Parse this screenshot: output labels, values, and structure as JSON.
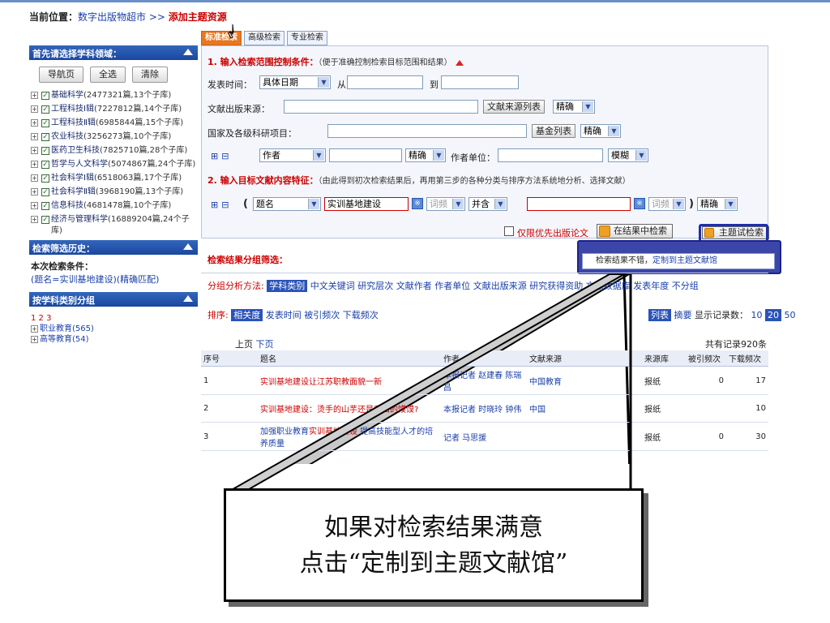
{
  "breadcrumb": {
    "label": "当前位置：",
    "site": "数字出版物超市",
    "sep": " >> ",
    "current": "添加主题资源"
  },
  "tabs": [
    {
      "label": "标准检索"
    },
    {
      "label": "高级检索"
    },
    {
      "label": "专业检索"
    }
  ],
  "left": {
    "subject_header": "首先请选择学科领域：",
    "buttons": [
      "导航页",
      "全选",
      "清除"
    ],
    "tree": [
      {
        "label": "基础科学",
        "sub": "(2477321篇,13个子库)"
      },
      {
        "label": "工程科技Ⅰ辑",
        "sub": "(7227812篇,14个子库)"
      },
      {
        "label": "工程科技Ⅱ辑",
        "sub": "(6985844篇,15个子库)"
      },
      {
        "label": "农业科技",
        "sub": "(3256273篇,10个子库)"
      },
      {
        "label": "医药卫生科技",
        "sub": "(7825710篇,28个子库)"
      },
      {
        "label": "哲学与人文科学",
        "sub": "(5074867篇,24个子库)"
      },
      {
        "label": "社会科学Ⅰ辑",
        "sub": "(6518063篇,17个子库)"
      },
      {
        "label": "社会科学Ⅱ辑",
        "sub": "(3968190篇,13个子库)"
      },
      {
        "label": "信息科技",
        "sub": "(4681478篇,10个子库)"
      },
      {
        "label": "经济与管理科学",
        "sub": "(16889204篇,24个子库)"
      }
    ],
    "history_header": "检索筛选历史：",
    "condition_label": "本次检索条件：",
    "condition_value": "(题名=实训基地建设)(精确匹配)",
    "group_header": "按学科类别分组",
    "group_pages": "1 2 3",
    "groups": [
      "职业教育(565)",
      "高等教育(54)"
    ]
  },
  "form": {
    "step1": "1. 输入检索范围控制条件：",
    "step1_note": "（便于准确控制检索目标范围和结果）",
    "pubtime_label": "发表时间：",
    "pubtime_select": "具体日期",
    "from_label": "从",
    "to_label": "到",
    "source_label": "文献出版来源：",
    "source_list_btn": "文献来源列表",
    "exact": "精确",
    "fund_label": "国家及各级科研项目：",
    "fund_list_btn": "基金列表",
    "author_select": "作者",
    "unit_label": "作者单位：",
    "fuzzy": "模糊",
    "step2": "2. 输入目标文献内容特征：",
    "step2_note": "（由此得到初次检索结果后，再用第三步的各种分类与排序方法系统地分析、选择文献）",
    "title_select": "题名",
    "title_value": "实训基地建设",
    "freq_select": "词频",
    "contains_select": "并含",
    "first_pub_label": "仅限优先出版论文",
    "search_in_results": "在结果中检索",
    "theme_search": "主题试检索"
  },
  "popup": {
    "text_prefix": "检索结果不错，",
    "text_link": "定制到主题文献馆"
  },
  "results": {
    "group_title": "检索结果分组筛选：",
    "methods_label": "分组分析方法:",
    "method_active": "学科类别",
    "methods": [
      "中文关键词",
      "研究层次",
      "文献作者",
      "作者单位",
      "文献出版来源",
      "研究获得资助",
      "文献数据库",
      "发表年度",
      "不分组"
    ],
    "sort_label": "排序:",
    "sort_active": "相关度",
    "sorts": [
      "发表时间",
      "被引频次",
      "下载频次"
    ],
    "list_label": "列表",
    "abstract_label": "摘要",
    "count_label": "显示记录数：",
    "counts": [
      "10",
      "20",
      "50"
    ],
    "prev": "上页",
    "next": "下页",
    "total": "共有记录920条",
    "columns": [
      "序号",
      "题名",
      "作者",
      "文献来源",
      "来源库",
      "被引频次",
      "下载频次"
    ],
    "rows": [
      {
        "no": "1",
        "title_hl": "实训基地建设",
        "title_rest": "让江苏职教面貌一新",
        "author": "本报记者 赵建春 陈瑞昌",
        "source": "中国教育",
        "db": "报纸",
        "cited": "0",
        "dl": "17"
      },
      {
        "no": "2",
        "title_hl": "实训基地建设",
        "title_rest": "：烫手的山芋还是香口的馍馍?",
        "author": "本报记者 时晓玲 钟伟",
        "source": "中国",
        "db": "报纸",
        "cited": "",
        "dl": "10"
      },
      {
        "no": "3",
        "title_pre": "加强职业教育",
        "title_hl": "实训基地建设",
        "title_rest": " 提高技能型人才的培养质量",
        "author": "记者 马思援",
        "source": "",
        "db": "报纸",
        "cited": "0",
        "dl": "30"
      }
    ]
  },
  "callout": {
    "line1": "如果对检索结果满意",
    "line2": "点击“定制到主题文献馆”"
  }
}
